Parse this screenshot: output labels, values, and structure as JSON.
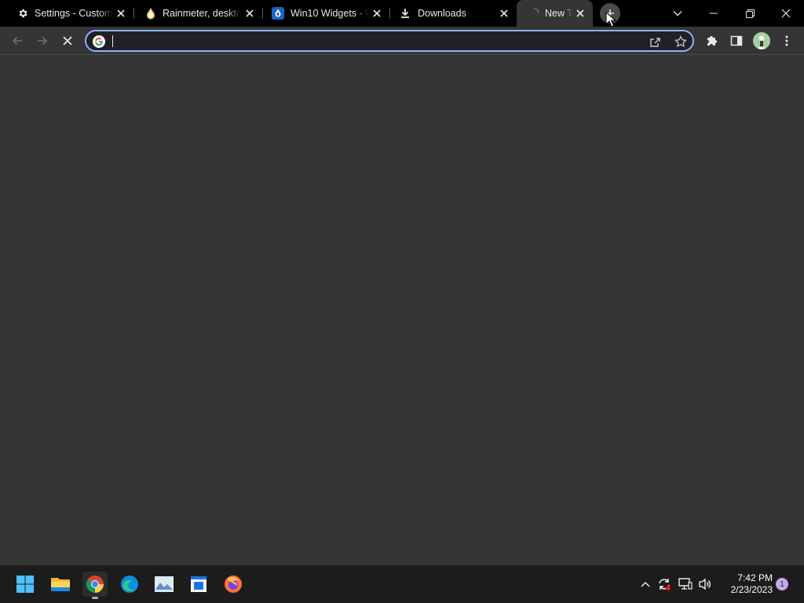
{
  "tabs": [
    {
      "title": "Settings - Customi",
      "icon": "gear-icon"
    },
    {
      "title": "Rainmeter, desktop",
      "icon": "rainmeter-drop-icon"
    },
    {
      "title": "Win10 Widgets - W",
      "icon": "win10-widgets-drop-icon"
    },
    {
      "title": "Downloads",
      "icon": "download-icon"
    },
    {
      "title": "New Tab",
      "icon": "loading-icon",
      "active": true
    }
  ],
  "omnibox": {
    "value": "",
    "placeholder": ""
  },
  "taskbar": {
    "apps": [
      "windows-start",
      "file-explorer",
      "chrome",
      "edge",
      "photos",
      "notepad",
      "firefox"
    ],
    "active_app": "chrome"
  },
  "clock": {
    "time": "7:42 PM",
    "date": "2/23/2023"
  },
  "notifications": {
    "count": "1"
  },
  "colors": {
    "accent": "#8ab4f8",
    "tab_bg": "#000000",
    "page_bg": "#353535",
    "taskbar_bg": "#1c1c1c",
    "notif_badge": "#c7a8ea"
  }
}
